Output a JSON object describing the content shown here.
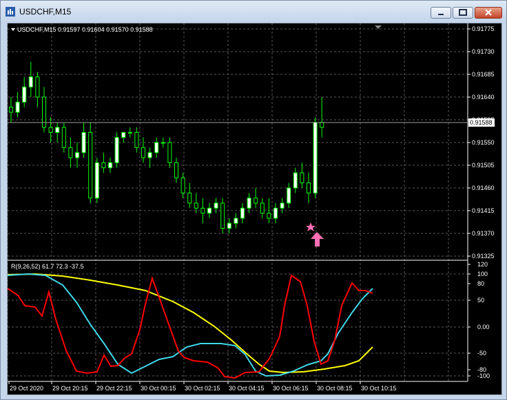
{
  "window": {
    "title": "USDCHF,M15"
  },
  "chart": {
    "info_text": "USDCHF,M15  0.91597 0.91604 0.91570 0.91588",
    "current_price_label": "0.91588",
    "price_ticks": [
      "0.91775",
      "0.91730",
      "0.91685",
      "0.91640",
      "0.91595",
      "0.91550",
      "0.91505",
      "0.91460",
      "0.91415",
      "0.91370",
      "0.91325"
    ],
    "time_labels": [
      "29 Oct 2020",
      "29 Oct 20:15",
      "29 Oct 22:15",
      "30 Oct 00:15",
      "30 Oct 02:15",
      "30 Oct 04:15",
      "30 Oct 06:15",
      "30 Oct 08:15",
      "30 Oct 10:15"
    ],
    "colors": {
      "bull": "#ffffff",
      "bear": "#00ff00",
      "grid": "#808080",
      "arrow": "#ff6fb5"
    }
  },
  "indicator": {
    "label": "R(9,26,52) 61.7 72.3 -37.5",
    "ticks": [
      "120",
      "100",
      "80",
      "50",
      "0.00",
      "-50",
      "-80",
      "-100"
    ],
    "colors": {
      "fast": "#ff0000",
      "mid": "#3fd8e8",
      "slow": "#ffff00"
    }
  },
  "chart_data": {
    "type": "line",
    "candles_ohlc_approx": [
      [
        0.9162,
        0.9164,
        0.9159,
        0.9161
      ],
      [
        0.9161,
        0.9165,
        0.916,
        0.9163
      ],
      [
        0.9163,
        0.9168,
        0.9162,
        0.9166
      ],
      [
        0.9166,
        0.9171,
        0.9164,
        0.9168
      ],
      [
        0.9168,
        0.9169,
        0.9162,
        0.9164
      ],
      [
        0.9164,
        0.9166,
        0.9157,
        0.9158
      ],
      [
        0.9158,
        0.916,
        0.9155,
        0.9157
      ],
      [
        0.9157,
        0.9159,
        0.9155,
        0.9158
      ],
      [
        0.9158,
        0.9159,
        0.9153,
        0.9154
      ],
      [
        0.9154,
        0.9156,
        0.915,
        0.9152
      ],
      [
        0.9152,
        0.9155,
        0.915,
        0.9153
      ],
      [
        0.9153,
        0.9159,
        0.9152,
        0.9157
      ],
      [
        0.9157,
        0.9159,
        0.9143,
        0.9144
      ],
      [
        0.9144,
        0.9152,
        0.9143,
        0.9151
      ],
      [
        0.9151,
        0.9153,
        0.9149,
        0.915
      ],
      [
        0.915,
        0.9152,
        0.9149,
        0.9151
      ],
      [
        0.9151,
        0.9157,
        0.915,
        0.9156
      ],
      [
        0.9156,
        0.9157,
        0.9155,
        0.9157
      ],
      [
        0.9157,
        0.9158,
        0.9156,
        0.9157
      ],
      [
        0.9157,
        0.9158,
        0.9153,
        0.9154
      ],
      [
        0.9154,
        0.9156,
        0.9151,
        0.9152
      ],
      [
        0.9152,
        0.9154,
        0.915,
        0.9153
      ],
      [
        0.9153,
        0.9156,
        0.9152,
        0.9155
      ],
      [
        0.9155,
        0.9156,
        0.9154,
        0.9155
      ],
      [
        0.9155,
        0.9156,
        0.915,
        0.9151
      ],
      [
        0.9151,
        0.9152,
        0.9147,
        0.9148
      ],
      [
        0.9148,
        0.9149,
        0.9144,
        0.9145
      ],
      [
        0.9145,
        0.9147,
        0.9142,
        0.9143
      ],
      [
        0.9143,
        0.9145,
        0.9141,
        0.9142
      ],
      [
        0.9142,
        0.9144,
        0.9139,
        0.9141
      ],
      [
        0.9141,
        0.9143,
        0.914,
        0.9142
      ],
      [
        0.9142,
        0.9144,
        0.9141,
        0.9143
      ],
      [
        0.9143,
        0.9144,
        0.9137,
        0.9138
      ],
      [
        0.9138,
        0.914,
        0.9137,
        0.9139
      ],
      [
        0.9139,
        0.9141,
        0.9138,
        0.914
      ],
      [
        0.914,
        0.9143,
        0.9139,
        0.9142
      ],
      [
        0.9142,
        0.9145,
        0.9141,
        0.9144
      ],
      [
        0.9144,
        0.9146,
        0.9142,
        0.9143
      ],
      [
        0.9143,
        0.9144,
        0.914,
        0.9141
      ],
      [
        0.9141,
        0.9144,
        0.9139,
        0.914
      ],
      [
        0.914,
        0.9143,
        0.9139,
        0.9142
      ],
      [
        0.9142,
        0.9144,
        0.9141,
        0.9143
      ],
      [
        0.9143,
        0.9147,
        0.9142,
        0.9146
      ],
      [
        0.9146,
        0.915,
        0.9145,
        0.9149
      ],
      [
        0.9149,
        0.9151,
        0.9146,
        0.9147
      ],
      [
        0.9147,
        0.9149,
        0.9143,
        0.9145
      ],
      [
        0.9145,
        0.916,
        0.9144,
        0.9159
      ],
      [
        0.9159,
        0.9164,
        0.9156,
        0.9158
      ]
    ],
    "ylim": [
      0.91325,
      0.91775
    ]
  }
}
